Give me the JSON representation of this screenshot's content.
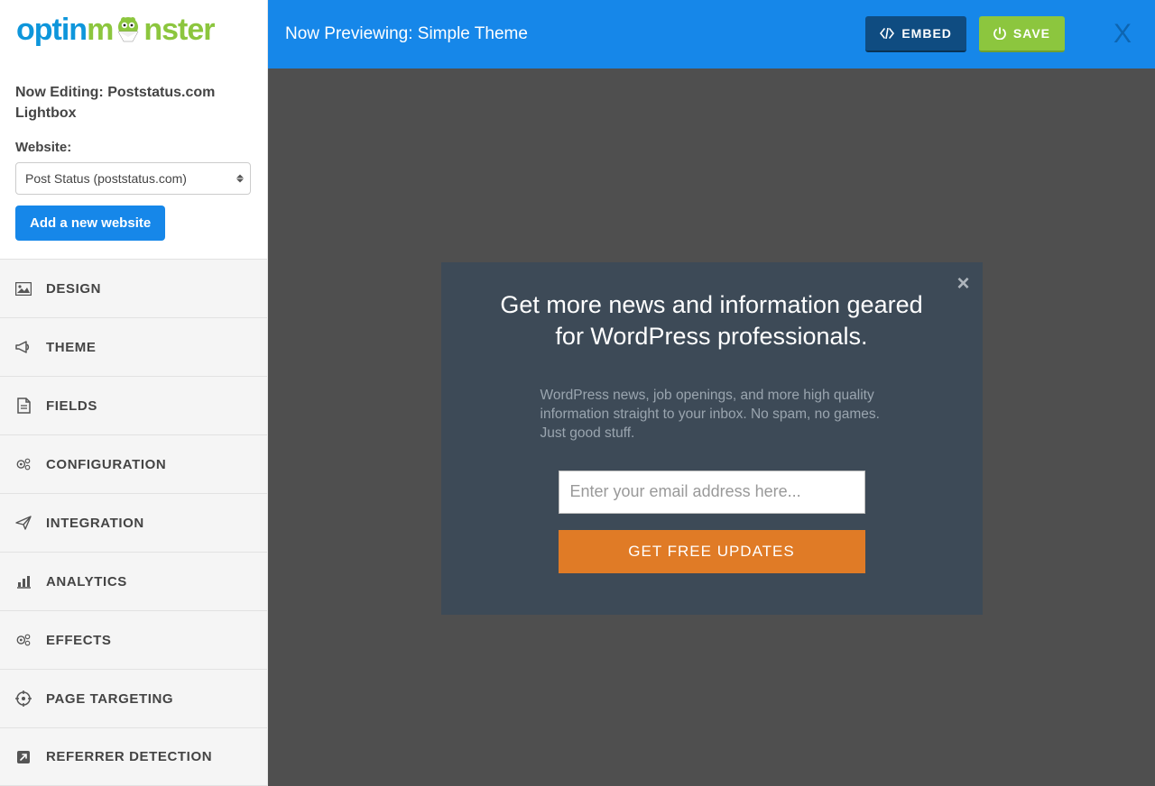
{
  "logo": {
    "part1": "optin",
    "part2": "m",
    "part3": "nster"
  },
  "sidebar": {
    "now_editing_label": "Now Editing: Poststatus.com Lightbox",
    "website_label": "Website:",
    "website_selected": "Post Status (poststatus.com)",
    "add_website_label": "Add a new website",
    "nav": [
      {
        "label": "DESIGN"
      },
      {
        "label": "THEME"
      },
      {
        "label": "FIELDS"
      },
      {
        "label": "CONFIGURATION"
      },
      {
        "label": "INTEGRATION"
      },
      {
        "label": "ANALYTICS"
      },
      {
        "label": "EFFECTS"
      },
      {
        "label": "PAGE TARGETING"
      },
      {
        "label": "REFERRER DETECTION"
      }
    ]
  },
  "topbar": {
    "preview_label": "Now Previewing: Simple Theme",
    "embed_label": "EMBED",
    "save_label": "SAVE",
    "close_label": "X"
  },
  "lightbox": {
    "title": "Get more news and information geared for WordPress professionals.",
    "description": "WordPress news, job openings, and more high quality information straight to your inbox. No spam, no games. Just good stuff.",
    "email_placeholder": "Enter your email address here...",
    "submit_label": "GET FREE UPDATES",
    "close_glyph": "×"
  }
}
